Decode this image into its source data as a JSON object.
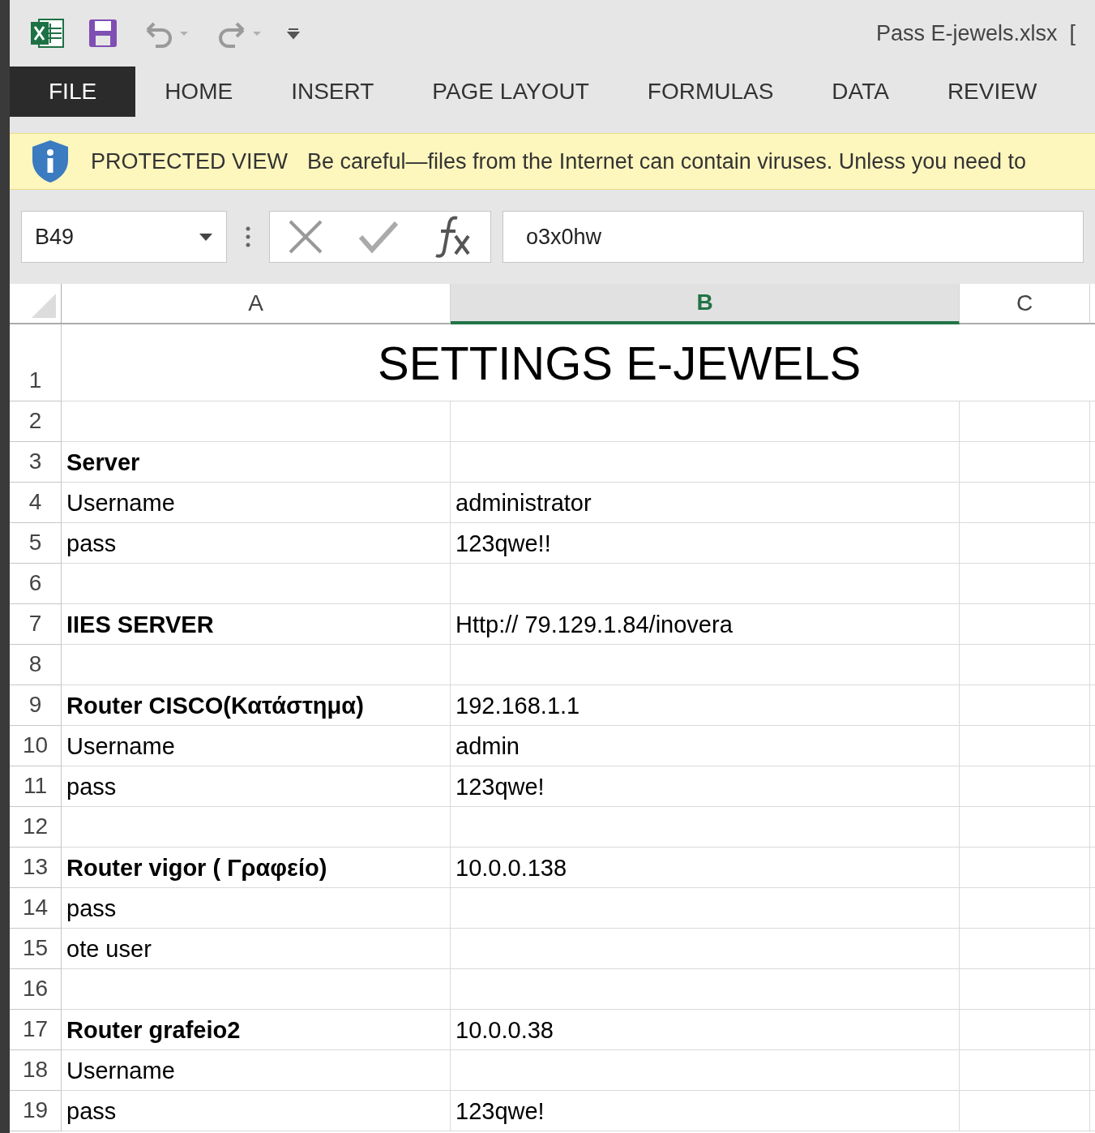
{
  "window": {
    "title": "Pass E-jewels.xlsx  ["
  },
  "ribbon_tabs": [
    {
      "label": "FILE",
      "selected": true
    },
    {
      "label": "HOME",
      "selected": false
    },
    {
      "label": "INSERT",
      "selected": false
    },
    {
      "label": "PAGE LAYOUT",
      "selected": false
    },
    {
      "label": "FORMULAS",
      "selected": false
    },
    {
      "label": "DATA",
      "selected": false
    },
    {
      "label": "REVIEW",
      "selected": false
    }
  ],
  "protected_bar": {
    "title": "PROTECTED VIEW",
    "message": "Be careful—files from the Internet can contain viruses. Unless you need to"
  },
  "formula_bar": {
    "name_box": "B49",
    "value": "o3x0hw"
  },
  "columns": [
    {
      "label": "A",
      "selected": false
    },
    {
      "label": "B",
      "selected": true
    },
    {
      "label": "C",
      "selected": false
    }
  ],
  "title_row": {
    "number": "1",
    "text": "SETTINGS E-JEWELS"
  },
  "rows": [
    {
      "number": "2"
    },
    {
      "number": "3",
      "a": "Server",
      "bold": true
    },
    {
      "number": "4",
      "a": "Username",
      "b": "administrator",
      "bold": false
    },
    {
      "number": "5",
      "a": "pass",
      "b": "123qwe!!",
      "bold": false
    },
    {
      "number": "6"
    },
    {
      "number": "7",
      "a": "IIES SERVER",
      "b": "Http:// 79.129.1.84/inovera",
      "bold": true
    },
    {
      "number": "8"
    },
    {
      "number": "9",
      "a": "Router CISCO(Κατάστημα)",
      "b": "192.168.1.1",
      "bold": true
    },
    {
      "number": "10",
      "a": "Username",
      "b": "admin",
      "bold": false
    },
    {
      "number": "11",
      "a": "pass",
      "b": "123qwe!",
      "bold": false
    },
    {
      "number": "12"
    },
    {
      "number": "13",
      "a": "Router vigor ( Γραφείο)",
      "b": "10.0.0.138",
      "bold": true
    },
    {
      "number": "14",
      "a": "pass",
      "bold": false
    },
    {
      "number": "15",
      "a": "ote user",
      "bold": false
    },
    {
      "number": "16"
    },
    {
      "number": "17",
      "a": "Router grafeio2",
      "b": "10.0.0.38",
      "bold": true
    },
    {
      "number": "18",
      "a": "Username",
      "bold": false
    },
    {
      "number": "19",
      "a": "pass",
      "b": "123qwe!",
      "bold": false
    }
  ]
}
